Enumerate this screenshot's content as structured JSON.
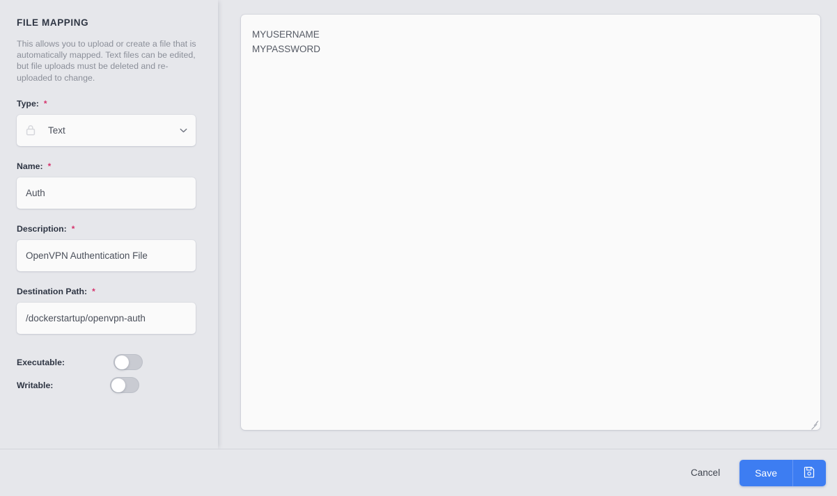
{
  "sidebar": {
    "title": "FILE MAPPING",
    "description": "This allows you to upload or create a file that is automatically mapped. Text files can be edited, but file uploads must be deleted and re-uploaded to change.",
    "fields": [
      {
        "label": "Type:",
        "required": "*",
        "value": "Text",
        "locked": true,
        "control": "select"
      },
      {
        "label": "Name:",
        "required": "*",
        "value": "Auth",
        "control": "text"
      },
      {
        "label": "Description:",
        "required": "*",
        "value": "OpenVPN Authentication File",
        "control": "text"
      },
      {
        "label": "Destination Path:",
        "required": "*",
        "value": "/dockerstartup/openvpn-auth",
        "control": "text"
      }
    ],
    "toggles": [
      {
        "label": "Executable:",
        "state": "off"
      },
      {
        "label": "Writable:",
        "state": "off"
      }
    ]
  },
  "editor": {
    "content": "MYUSERNAME\nMYPASSWORD",
    "resize_handle": "resize-grip"
  },
  "footer": {
    "cancel_label": "Cancel",
    "save_label": "Save",
    "save_icon": "floppy-disk-icon"
  },
  "colors": {
    "accent": "#3d7df2",
    "required_asterisk": "#d6336c",
    "background": "#e6e7eb",
    "surface": "#fafafa",
    "heading": "#2e3543",
    "muted_text": "#8b8f99"
  }
}
